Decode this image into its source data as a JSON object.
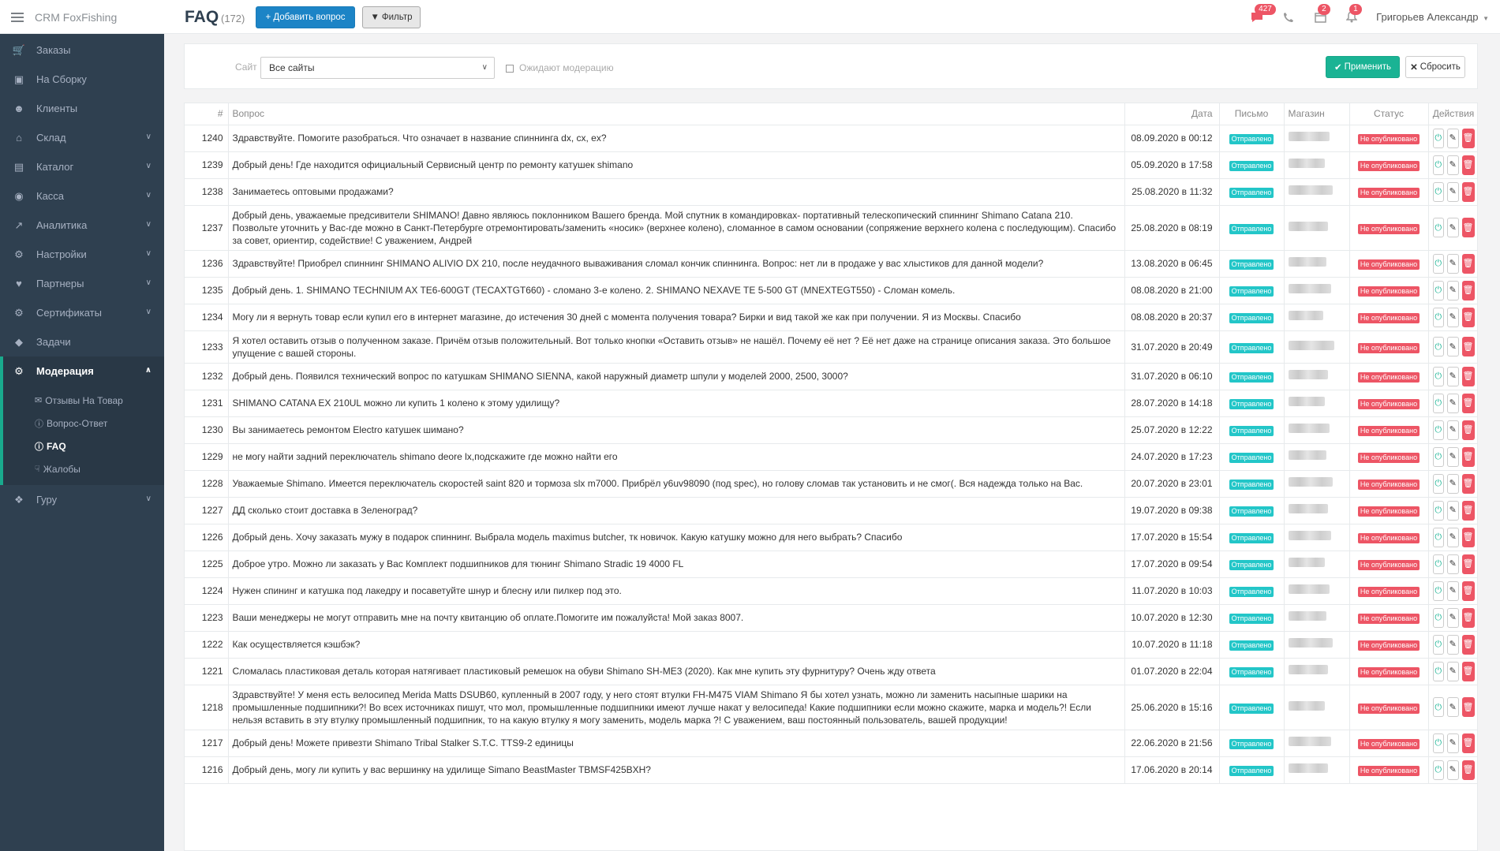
{
  "app": {
    "brand": "CRM FoxFishing"
  },
  "header": {
    "title": "FAQ",
    "count": "(172)",
    "add_label": "+ Добавить вопрос",
    "filter_label": "Фильтр",
    "messages_badge": "427",
    "cart_badge": "2",
    "bell_badge": "1",
    "user_name": "Григорьев Александр"
  },
  "sidebar": {
    "items": [
      {
        "label": "Заказы",
        "icon": "cart-icon"
      },
      {
        "label": "На Сборку",
        "icon": "inbox-icon"
      },
      {
        "label": "Клиенты",
        "icon": "users-icon"
      },
      {
        "label": "Склад",
        "icon": "home-icon",
        "has_children": true
      },
      {
        "label": "Каталог",
        "icon": "list-icon",
        "has_children": true
      },
      {
        "label": "Касса",
        "icon": "money-icon",
        "has_children": true
      },
      {
        "label": "Аналитика",
        "icon": "chart-icon",
        "has_children": true
      },
      {
        "label": "Настройки",
        "icon": "gears-icon",
        "has_children": true
      },
      {
        "label": "Партнеры",
        "icon": "handshake-icon",
        "has_children": true
      },
      {
        "label": "Сертификаты",
        "icon": "cog-icon",
        "has_children": true
      },
      {
        "label": "Задачи",
        "icon": "tag-icon"
      },
      {
        "label": "Модерация",
        "icon": "cogs-icon",
        "has_children": true,
        "expanded": true
      },
      {
        "label": "Гуру",
        "icon": "walker-icon",
        "has_children": true
      }
    ],
    "moderation_sub": [
      {
        "label": "Отзывы На Товар",
        "icon": "comments-icon"
      },
      {
        "label": "Вопрос-Ответ",
        "icon": "question-icon"
      },
      {
        "label": "FAQ",
        "icon": "question-icon"
      },
      {
        "label": "Жалобы",
        "icon": "thumbs-down-icon"
      }
    ]
  },
  "filters": {
    "site_label": "Сайт",
    "site_value": "Все сайты",
    "moderation_label": "Ожидают модерацию",
    "apply_label": "Применить",
    "reset_label": "Сбросить"
  },
  "table": {
    "headers": [
      "#",
      "Вопрос",
      "Дата",
      "Письмо",
      "Магазин",
      "Статус",
      "Действия"
    ],
    "rows": [
      {
        "id": "1240",
        "question": "Здравствуйте. Помогите разобраться. Что означает в название спиннинга dx, cx, ex?",
        "date": "08.09.2020 в 00:12",
        "letter": "Отправлено",
        "status": "Не опубликовано"
      },
      {
        "id": "1239",
        "question": "Добрый день! Где находится официальный Сервисный центр по ремонту катушек shimano",
        "date": "05.09.2020 в 17:58",
        "letter": "Отправлено",
        "status": "Не опубликовано"
      },
      {
        "id": "1238",
        "question": "Занимаетесь оптовыми продажами?",
        "date": "25.08.2020 в 11:32",
        "letter": "Отправлено",
        "status": "Не опубликовано"
      },
      {
        "id": "1237",
        "question": "Добрый день, уважаемые предсивители SHIMANO! Давно являюсь поклонником Вашего бренда. Мой спутник в командировках- портативный телескопический спиннинг Shimano Catana 210. Позвольте уточнить у Вас-где можно в Санкт-Петербурге отремонтировать/заменить «носик» (верхнее колено), сломанное в самом основании (сопряжение верхнего колена с последующим). Спасибо за совет, ориентир, содействие! С уважением, Андрей",
        "date": "25.08.2020 в 08:19",
        "letter": "Отправлено",
        "status": "Не опубликовано"
      },
      {
        "id": "1236",
        "question": "Здравствуйте! Приобрел спиннинг SHIMANO ALIVIO DX 210, после неудачного вываживания сломал кончик спиннинга. Вопрос: нет ли в продаже у вас хлыстиков для данной модели?",
        "date": "13.08.2020 в 06:45",
        "letter": "Отправлено",
        "status": "Не опубликовано"
      },
      {
        "id": "1235",
        "question": "Добрый день. 1. SHIMANO TECHNIUM AX TE6-600GT (TECAXTGT660) - сломано 3-е колено. 2. SHIMANO NEXAVE TE 5-500 GT (MNEXTEGT550) - Сломан комель.",
        "date": "08.08.2020 в 21:00",
        "letter": "Отправлено",
        "status": "Не опубликовано"
      },
      {
        "id": "1234",
        "question": "Могу ли я вернуть товар если купил его в интернет магазине, до истечения 30 дней с момента получения товара? Бирки и вид такой же как при получении. Я из Москвы. Спасибо",
        "date": "08.08.2020 в 20:37",
        "letter": "Отправлено",
        "status": "Не опубликовано"
      },
      {
        "id": "1233",
        "question": "Я хотел оставить отзыв о полученном заказе. Причём отзыв положительный. Вот только кнопки «Оставить отзыв» не нашёл. Почему её нет ? Её нет даже на странице описания заказа. Это большое упущение с вашей стороны.",
        "date": "31.07.2020 в 20:49",
        "letter": "Отправлено",
        "status": "Не опубликовано"
      },
      {
        "id": "1232",
        "question": "Добрый день. Появился технический вопрос по катушкам SHIMANO SIENNA, какой наружный диаметр шпули у моделей 2000, 2500, 3000?",
        "date": "31.07.2020 в 06:10",
        "letter": "Отправлено",
        "status": "Не опубликовано"
      },
      {
        "id": "1231",
        "question": "SHIMANO CATANA EX 210UL можно ли купить 1 колено к этому удилищу?",
        "date": "28.07.2020 в 14:18",
        "letter": "Отправлено",
        "status": "Не опубликовано"
      },
      {
        "id": "1230",
        "question": "Вы занимаетесь ремонтом Electro катушек шимано?",
        "date": "25.07.2020 в 12:22",
        "letter": "Отправлено",
        "status": "Не опубликовано"
      },
      {
        "id": "1229",
        "question": "не могу найти задний переключатель shimano deore lx,подскажите где можно найти его",
        "date": "24.07.2020 в 17:23",
        "letter": "Отправлено",
        "status": "Не опубликовано"
      },
      {
        "id": "1228",
        "question": "Уважаемые Shimano. Имеется переключатель скоростей saint 820 и тормоза slx m7000. Прибрёл у6uv98090 (под spec), но голову сломав так установить и не смог(. Вся надежда только на Вас.",
        "date": "20.07.2020 в 23:01",
        "letter": "Отправлено",
        "status": "Не опубликовано"
      },
      {
        "id": "1227",
        "question": "ДД сколько стоит доставка в Зеленоград?",
        "date": "19.07.2020 в 09:38",
        "letter": "Отправлено",
        "status": "Не опубликовано"
      },
      {
        "id": "1226",
        "question": "Добрый день. Хочу заказать мужу в подарок спиннинг. Выбрала модель maximus butcher, тк новичок. Какую катушку можно для него выбрать? Спасибо",
        "date": "17.07.2020 в 15:54",
        "letter": "Отправлено",
        "status": "Не опубликовано"
      },
      {
        "id": "1225",
        "question": "Доброе утро. Можно ли заказать у Вас Комплект подшипников для тюнинг Shimano Stradic 19 4000 FL",
        "date": "17.07.2020 в 09:54",
        "letter": "Отправлено",
        "status": "Не опубликовано"
      },
      {
        "id": "1224",
        "question": "Нужен спининг и катушка под лакедру и посаветуйте шнур и блесну или пилкер под это.",
        "date": "11.07.2020 в 10:03",
        "letter": "Отправлено",
        "status": "Не опубликовано"
      },
      {
        "id": "1223",
        "question": "Ваши менеджеры не могут отправить мне на почту квитанцию об оплате.Помогите им пожалуйста! Мой заказ 8007.",
        "date": "10.07.2020 в 12:30",
        "letter": "Отправлено",
        "status": "Не опубликовано"
      },
      {
        "id": "1222",
        "question": "Как осуществляется кэшбэк?",
        "date": "10.07.2020 в 11:18",
        "letter": "Отправлено",
        "status": "Не опубликовано"
      },
      {
        "id": "1221",
        "question": "Сломалась пластиковая деталь которая натягивает пластиковый ремешок на обуви Shimano SH-ME3 (2020). Как мне купить эту фурнитуру? Очень жду ответа",
        "date": "01.07.2020 в 22:04",
        "letter": "Отправлено",
        "status": "Не опубликовано"
      },
      {
        "id": "1218",
        "question": "Здравствуйте! У меня есть велосипед Merida Matts DSUB60, купленный в 2007 году, у него стоят втулки FH-M475 VIAM Shimano Я бы хотел узнать, можно ли заменить насыпные шарики на промышленные подшипники?! Во всех источниках пишут, что мол, промышленные подшипники имеют лучше накат у велосипеда! Какие подшипники если можно скажите, марка и модель?! Если нельзя вставить в эту втулку промышленный подшипник, то на какую втулку я могу заменить, модель марка ?! С уважением, ваш постоянный пользователь, вашей продукции!",
        "date": "25.06.2020 в 15:16",
        "letter": "Отправлено",
        "status": "Не опубликовано"
      },
      {
        "id": "1217",
        "question": "Добрый день! Можете привезти Shimano Tribal Stalker S.T.C. TTS9-2 единицы",
        "date": "22.06.2020 в 21:56",
        "letter": "Отправлено",
        "status": "Не опубликовано"
      },
      {
        "id": "1216",
        "question": "Добрый день, могу ли купить у вас вершинку на удилище Simano BeastMaster TBMSF425BXH?",
        "date": "17.06.2020 в 20:14",
        "letter": "Отправлено",
        "status": "Не опубликовано"
      }
    ]
  }
}
